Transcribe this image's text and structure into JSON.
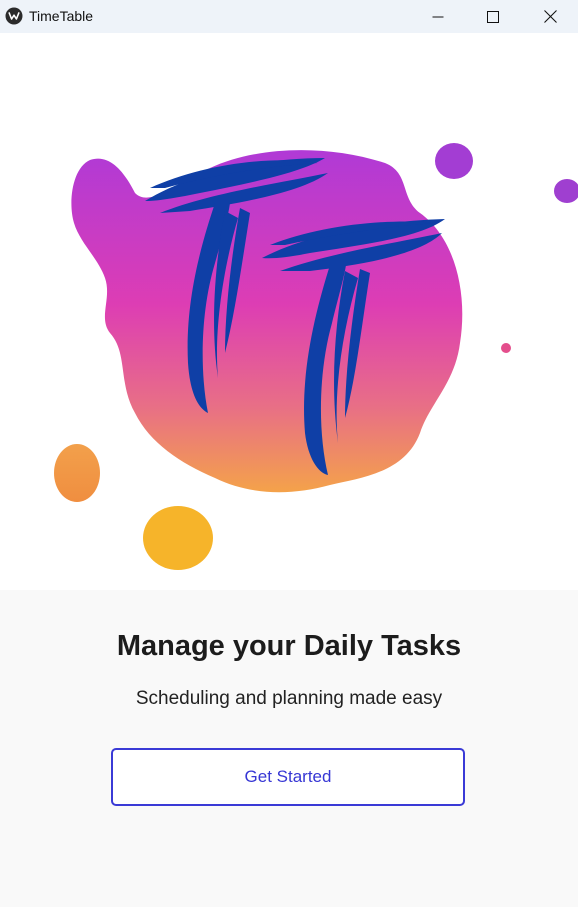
{
  "window": {
    "title": "TimeTable",
    "icon": "kivy-logo-icon"
  },
  "controls": {
    "minimize": "minimize-icon",
    "maximize": "maximize-icon",
    "close": "close-icon"
  },
  "hero": {
    "logo": "tt-logo-splash",
    "colors": {
      "gradient_top": "#b03ad6",
      "gradient_mid": "#dd3db4",
      "gradient_bottom": "#f4a24a",
      "letters": "#0f3fa6",
      "yellow_blob": "#f6b42a"
    }
  },
  "main": {
    "heading": "Manage your Daily Tasks",
    "subheading": "Scheduling and planning made easy",
    "cta_label": "Get Started"
  },
  "theme": {
    "accent": "#3a3ad6",
    "background": "#f9f9f9"
  }
}
